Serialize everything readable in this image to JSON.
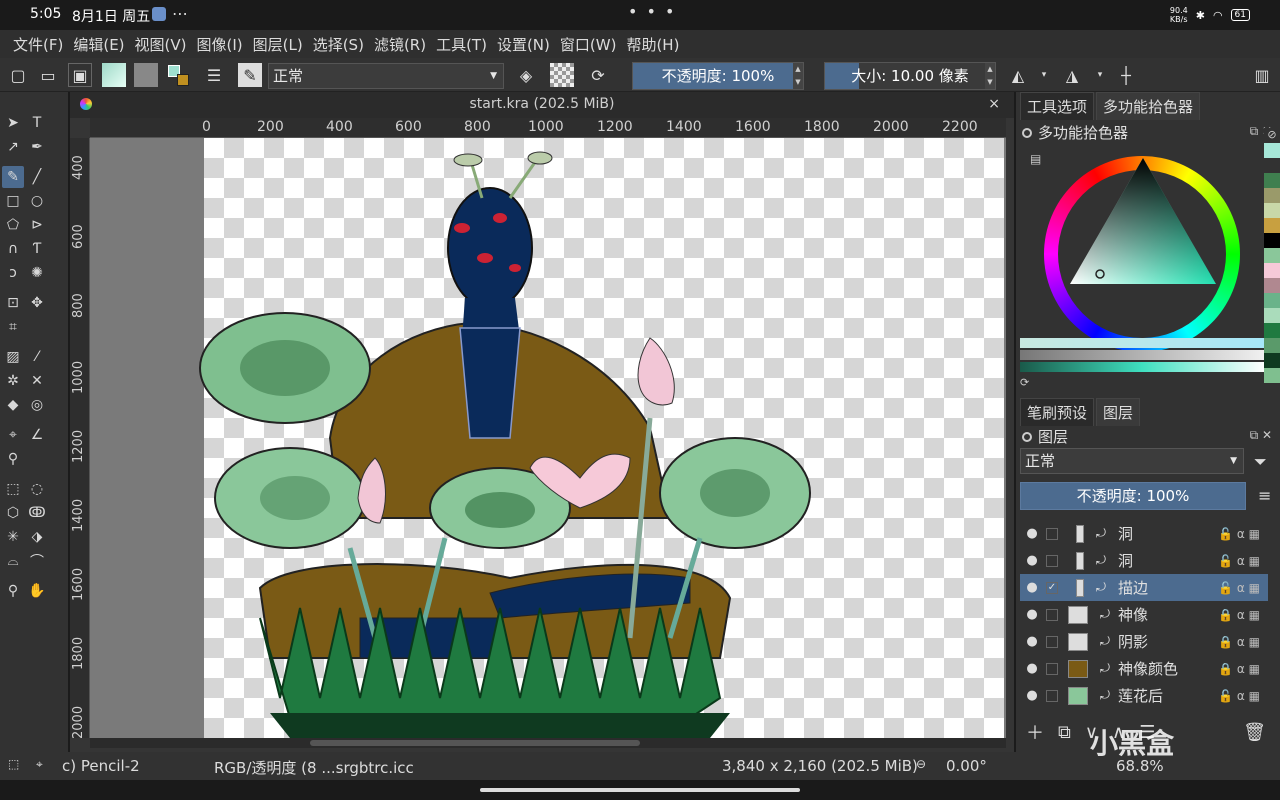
{
  "system_bar": {
    "time": "5:05",
    "date": "8月1日 周五",
    "net_speed_top": "90.4",
    "net_speed_bottom": "KB/s",
    "battery": "61"
  },
  "menu": [
    "文件(F)",
    "编辑(E)",
    "视图(V)",
    "图像(I)",
    "图层(L)",
    "选择(S)",
    "滤镜(R)",
    "工具(T)",
    "设置(N)",
    "窗口(W)",
    "帮助(H)"
  ],
  "toolbar": {
    "blend_mode": "正常",
    "opacity_label": "不透明度: 100%",
    "size_label": "大小: 10.00 像素"
  },
  "document": {
    "title": "start.kra (202.5 MiB)",
    "close": "×",
    "ruler_h": [
      "0",
      "200",
      "400",
      "600",
      "800",
      "1000",
      "1200",
      "1400",
      "1600",
      "1800",
      "2000",
      "2200"
    ],
    "ruler_v": [
      "400",
      "600",
      "800",
      "1000",
      "1200",
      "1400",
      "1600",
      "1800",
      "2000"
    ]
  },
  "right_panel": {
    "tabs": [
      "工具选项",
      "多功能拾色器"
    ],
    "color_selector_title": "多功能拾色器",
    "layer_tabs": [
      "笔刷预设",
      "图层"
    ],
    "layers_title": "图层",
    "layer_blend": "正常",
    "layer_opacity": "不透明度: 100%",
    "layers": [
      {
        "name": "洞",
        "visible": true,
        "checked": false,
        "selected": false,
        "locked": false
      },
      {
        "name": "洞",
        "visible": true,
        "checked": false,
        "selected": false,
        "locked": false
      },
      {
        "name": "描边",
        "visible": true,
        "checked": true,
        "selected": true,
        "locked": false
      },
      {
        "name": "神像",
        "visible": true,
        "checked": false,
        "selected": false,
        "locked": true
      },
      {
        "name": "阴影",
        "visible": true,
        "checked": false,
        "selected": false,
        "locked": true
      },
      {
        "name": "神像颜色",
        "visible": true,
        "checked": false,
        "selected": false,
        "locked": true
      },
      {
        "name": "莲花后",
        "visible": true,
        "checked": false,
        "selected": false,
        "locked": false
      }
    ]
  },
  "status": {
    "brush": "c) Pencil-2",
    "color_space": "RGB/透明度 (8 ...srgbtrc.icc",
    "dimensions": "3,840 x 2,160 (202.5 MiB)",
    "rotation": "0.00°",
    "zoom": "68.8%"
  },
  "watermark": "小黑盒",
  "colors": {
    "accent": "#4c6b8f",
    "bg": "#323232"
  }
}
